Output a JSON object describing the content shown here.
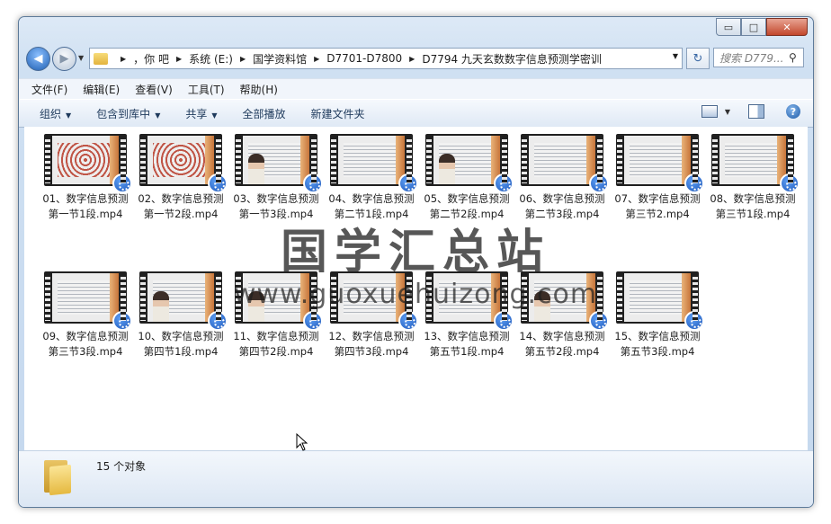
{
  "window": {
    "caption_buttons": {
      "minimize": "▭",
      "maximize": "□",
      "close": "✕"
    }
  },
  "nav": {
    "back_icon": "◀",
    "forward_icon": "▶",
    "history_dropdown": "▼",
    "breadcrumbs": [
      "，你  吧",
      "系统 (E:)",
      "国学资料馆",
      "D7701-D7800",
      "D7794 九天玄数数字信息预测学密训"
    ],
    "address_dropdown": "▼",
    "refresh_icon": "↻",
    "search_placeholder": "搜索 D779...",
    "search_icon": "⚲"
  },
  "menu": {
    "file": "文件(F)",
    "edit": "编辑(E)",
    "view": "查看(V)",
    "tools": "工具(T)",
    "help": "帮助(H)"
  },
  "toolbar": {
    "organize": "组织",
    "include_library": "包含到库中",
    "share": "共享",
    "play_all": "全部播放",
    "new_folder": "新建文件夹",
    "dropdown_arrow": "▼",
    "help_icon": "?"
  },
  "files": [
    {
      "name": "01、数字信息预测第一节1段.mp4",
      "style": "dark"
    },
    {
      "name": "02、数字信息预测第一节2段.mp4",
      "style": "dark"
    },
    {
      "name": "03、数字信息预测第一节3段.mp4",
      "style": "person"
    },
    {
      "name": "04、数字信息预测第二节1段.mp4",
      "style": "board"
    },
    {
      "name": "05、数字信息预测第二节2段.mp4",
      "style": "person"
    },
    {
      "name": "06、数字信息预测第二节3段.mp4",
      "style": "board"
    },
    {
      "name": "07、数字信息预测第三节2.mp4",
      "style": "board"
    },
    {
      "name": "08、数字信息预测第三节1段.mp4",
      "style": "board"
    },
    {
      "name": "09、数字信息预测第三节3段.mp4",
      "style": "board"
    },
    {
      "name": "10、数字信息预测第四节1段.mp4",
      "style": "person"
    },
    {
      "name": "11、数字信息预测第四节2段.mp4",
      "style": "person"
    },
    {
      "name": "12、数字信息预测第四节3段.mp4",
      "style": "board"
    },
    {
      "name": "13、数字信息预测第五节1段.mp4",
      "style": "board"
    },
    {
      "name": "14、数字信息预测第五节2段.mp4",
      "style": "person"
    },
    {
      "name": "15、数字信息预测第五节3段.mp4",
      "style": "board"
    }
  ],
  "status": {
    "count_text": "15 个对象"
  },
  "watermark": {
    "title": "国学汇总站",
    "url": "www.guoxuehuizong.com"
  }
}
